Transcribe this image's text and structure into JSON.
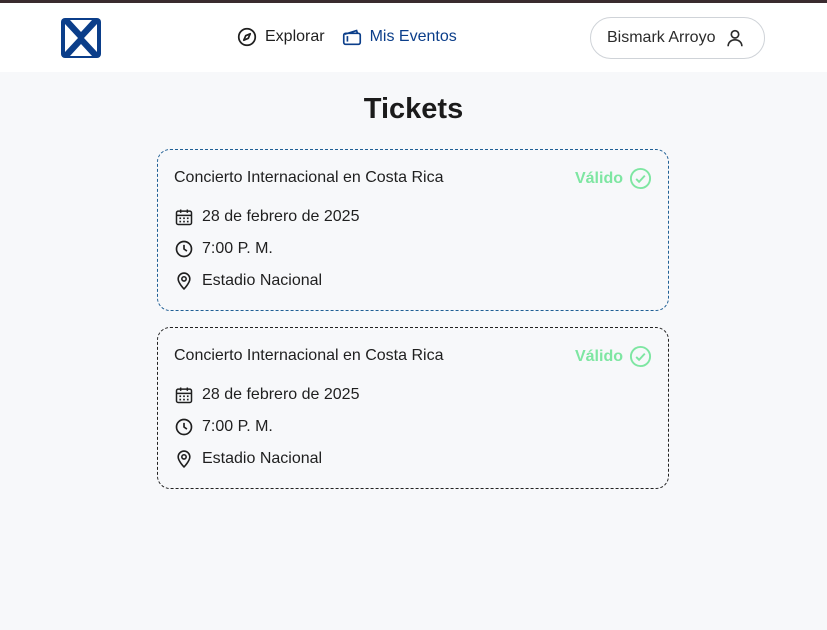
{
  "nav": {
    "explore_label": "Explorar",
    "events_label": "Mis Eventos",
    "user_name": "Bismark Arroyo"
  },
  "page": {
    "title": "Tickets"
  },
  "tickets": [
    {
      "event": "Concierto Internacional en Costa Rica",
      "status": "Válido",
      "date": "28 de febrero de 2025",
      "time": "7:00 P. M.",
      "venue": "Estadio Nacional"
    },
    {
      "event": "Concierto Internacional en Costa Rica",
      "status": "Válido",
      "date": "28 de febrero de 2025",
      "time": "7:00 P. M.",
      "venue": "Estadio Nacional"
    }
  ],
  "colors": {
    "brand": "#0b3e8a",
    "valid": "#7ee6a2",
    "background": "#f7f8fa"
  },
  "icons": [
    "logo-icon",
    "compass-icon",
    "ticket-icon",
    "user-icon",
    "calendar-icon",
    "clock-icon",
    "location-pin-icon",
    "check-circle-icon"
  ]
}
